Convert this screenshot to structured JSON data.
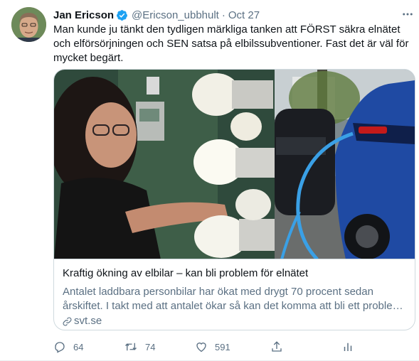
{
  "tweet": {
    "author_name": "Jan Ericson",
    "author_handle": "@Ericson_ubbhult",
    "separator": "·",
    "time": "Oct 27",
    "text_lines": [
      "Man kunde ju tänkt den tydligen märkliga tanken att FÖRST säkra elnätet",
      "och elförsörjningen och SEN satsa på elbilssubventioner. Fast det är väl för",
      "mycket begärt."
    ]
  },
  "card": {
    "title": "Kraftig ökning av elbilar – kan bli problem för elnätet",
    "desc_lines": [
      "Antalet laddbara personbilar har ökat med drygt 70 procent sedan",
      "årskiftet. I takt med att antalet ökar så kan det komma att bli ett problem för elnätet"
    ],
    "domain": "svt.se"
  },
  "actions": {
    "replies": "64",
    "retweets": "74",
    "likes": "591"
  },
  "icons": {
    "verified": "verified-badge-icon",
    "more": "more-options-icon",
    "reply": "reply-icon",
    "retweet": "retweet-icon",
    "like": "heart-icon",
    "share": "share-icon",
    "link": "link-icon",
    "analytics": "analytics-icon"
  },
  "colors": {
    "verified_blue": "#1da1f2",
    "secondary_text": "#5b7083",
    "primary_text": "#0f1419",
    "border": "#cfd9de"
  }
}
